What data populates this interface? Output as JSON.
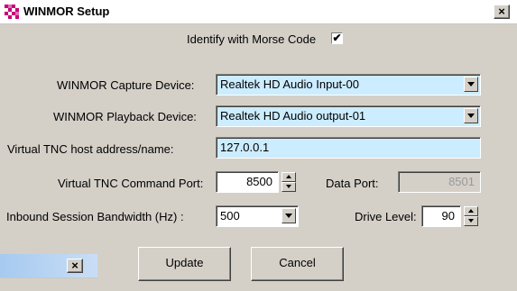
{
  "window": {
    "title": "WINMOR Setup"
  },
  "identify": {
    "label": "Identify with Morse Code",
    "checked_mark": "✔"
  },
  "capture": {
    "label": "WINMOR Capture Device:",
    "value": "Realtek HD Audio Input-00"
  },
  "playback": {
    "label": "WINMOR Playback Device:",
    "value": "Realtek HD Audio output-01"
  },
  "host": {
    "label": "Virtual TNC host address/name:",
    "value": "127.0.0.1"
  },
  "command_port": {
    "label": "Virtual TNC Command Port:",
    "value": "8500"
  },
  "data_port": {
    "label": "Data Port:",
    "value": "8501"
  },
  "bandwidth": {
    "label": "Inbound Session Bandwidth (Hz) :",
    "value": "500"
  },
  "drive": {
    "label": "Drive Level:",
    "value": "90"
  },
  "buttons": {
    "update": "Update",
    "cancel": "Cancel"
  },
  "close_glyph": "×",
  "colors": {
    "field_bg": "#ccecff",
    "dialog_bg": "#d4d0c8"
  }
}
